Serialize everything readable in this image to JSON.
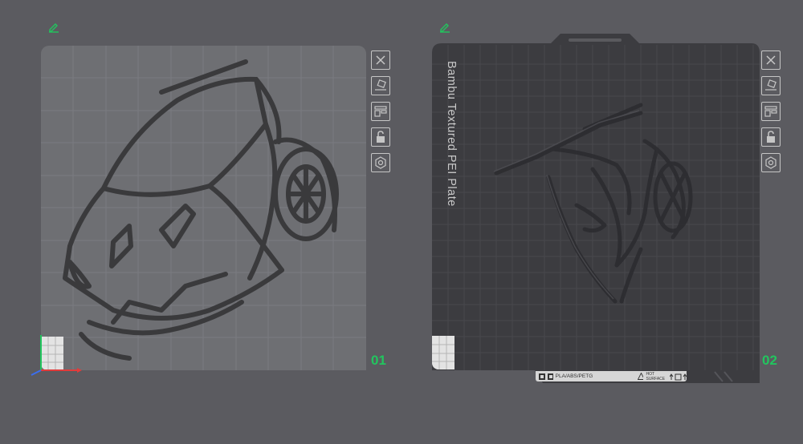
{
  "plates": [
    {
      "number": "01",
      "tools": [
        "close-icon",
        "auto-orient-icon",
        "arrange-icon",
        "lock-icon",
        "settings-icon"
      ]
    },
    {
      "number": "02",
      "plate_type": "Bambu Textured PEI Plate",
      "filament_label": "PLA/ABS/PETG",
      "surface_label_line1": "HOT",
      "surface_label_line2": "SURFACE",
      "tools": [
        "close-icon",
        "auto-orient-icon",
        "arrange-icon",
        "lock-icon",
        "settings-icon"
      ]
    }
  ],
  "colors": {
    "background": "#5b5b60",
    "plate1_surface": "#6e6f73",
    "plate2_surface": "#3c3c40",
    "accent_green": "#22c55e",
    "model_stroke": "#3a3a3c"
  }
}
